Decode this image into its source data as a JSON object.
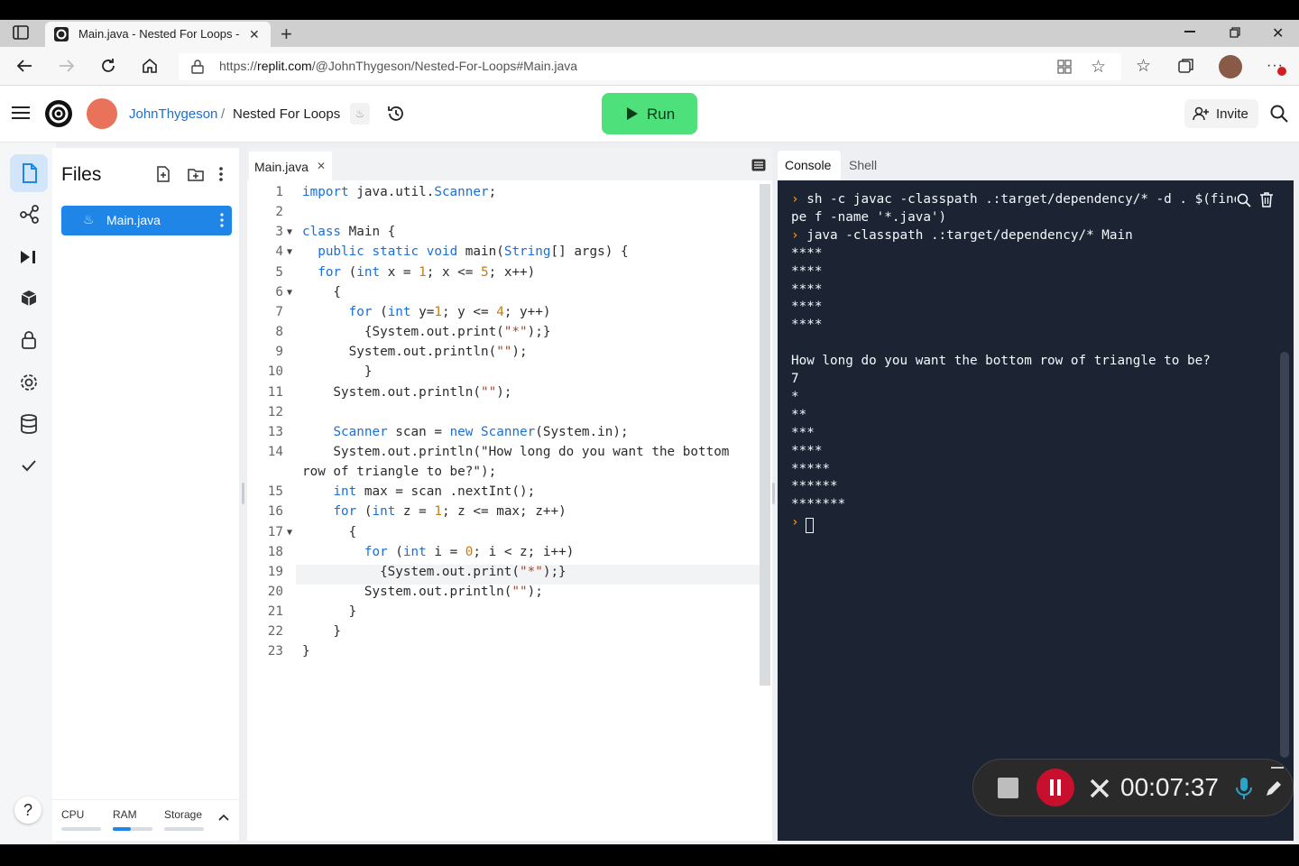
{
  "browser": {
    "tab_title": "Main.java - Nested For Loops - R",
    "url_prefix": "https://",
    "url_host": "replit.com",
    "url_path": "/@JohnThygeson/Nested-For-Loops#Main.java"
  },
  "header": {
    "owner": "JohnThygeson",
    "separator": "/",
    "repl_name": "Nested For Loops",
    "run_label": "Run",
    "invite_label": "Invite"
  },
  "files": {
    "title": "Files",
    "items": [
      {
        "name": "Main.java"
      }
    ]
  },
  "resources": {
    "cpu_label": "CPU",
    "ram_label": "RAM",
    "storage_label": "Storage",
    "cpu_usage": 0.0,
    "ram_usage": 0.45,
    "storage_usage": 0.0
  },
  "editor": {
    "tab_label": "Main.java",
    "active_line": 19,
    "lines": [
      {
        "n": "1",
        "text": "import java.util.Scanner;"
      },
      {
        "n": "2",
        "text": ""
      },
      {
        "n": "3",
        "text": "class Main {"
      },
      {
        "n": "4",
        "text": "  public static void main(String[] args) {"
      },
      {
        "n": "5",
        "text": "  for (int x = 1; x <= 5; x++)"
      },
      {
        "n": "6",
        "text": "    {"
      },
      {
        "n": "7",
        "text": "      for (int y=1; y <= 4; y++)"
      },
      {
        "n": "8",
        "text": "        {System.out.print(\"*\");}"
      },
      {
        "n": "9",
        "text": "      System.out.println(\"\");"
      },
      {
        "n": "10",
        "text": "        }"
      },
      {
        "n": "11",
        "text": "    System.out.println(\"\");"
      },
      {
        "n": "12",
        "text": ""
      },
      {
        "n": "13",
        "text": "    Scanner scan = new Scanner(System.in);"
      },
      {
        "n": "14",
        "text": "    System.out.println(\"How long do you want the bottom"
      },
      {
        "n": "",
        "text": "row of triangle to be?\");"
      },
      {
        "n": "15",
        "text": "    int max = scan .nextInt();"
      },
      {
        "n": "16",
        "text": "    for (int z = 1; z <= max; z++)"
      },
      {
        "n": "17",
        "text": "      {"
      },
      {
        "n": "18",
        "text": "        for (int i = 0; i < z; i++)"
      },
      {
        "n": "19",
        "text": "          {System.out.print(\"*\");}"
      },
      {
        "n": "20",
        "text": "        System.out.println(\"\");"
      },
      {
        "n": "21",
        "text": "      }"
      },
      {
        "n": "22",
        "text": "    }"
      },
      {
        "n": "23",
        "text": "}"
      }
    ]
  },
  "console": {
    "tabs": [
      "Console",
      "Shell"
    ],
    "lines": [
      {
        "prompt": true,
        "text": "sh -c javac -classpath .:target/dependency/* -d . $(find"
      },
      {
        "prompt": false,
        "text": "pe f -name '*.java')"
      },
      {
        "prompt": true,
        "text": "java -classpath .:target/dependency/* Main"
      },
      {
        "prompt": false,
        "text": "****"
      },
      {
        "prompt": false,
        "text": "****"
      },
      {
        "prompt": false,
        "text": "****"
      },
      {
        "prompt": false,
        "text": "****"
      },
      {
        "prompt": false,
        "text": "****"
      },
      {
        "prompt": false,
        "text": ""
      },
      {
        "prompt": false,
        "text": "How long do you want the bottom row of triangle to be?"
      },
      {
        "prompt": false,
        "text": "7"
      },
      {
        "prompt": false,
        "text": "*"
      },
      {
        "prompt": false,
        "text": "**"
      },
      {
        "prompt": false,
        "text": "***"
      },
      {
        "prompt": false,
        "text": "****"
      },
      {
        "prompt": false,
        "text": "*****"
      },
      {
        "prompt": false,
        "text": "******"
      },
      {
        "prompt": false,
        "text": "*******"
      }
    ]
  },
  "recorder": {
    "time": "00:07:37"
  },
  "colors": {
    "accent_blue": "#1f86e8",
    "run_green": "#4ee07a",
    "console_bg": "#1c2333",
    "record_red": "#c8102e"
  }
}
